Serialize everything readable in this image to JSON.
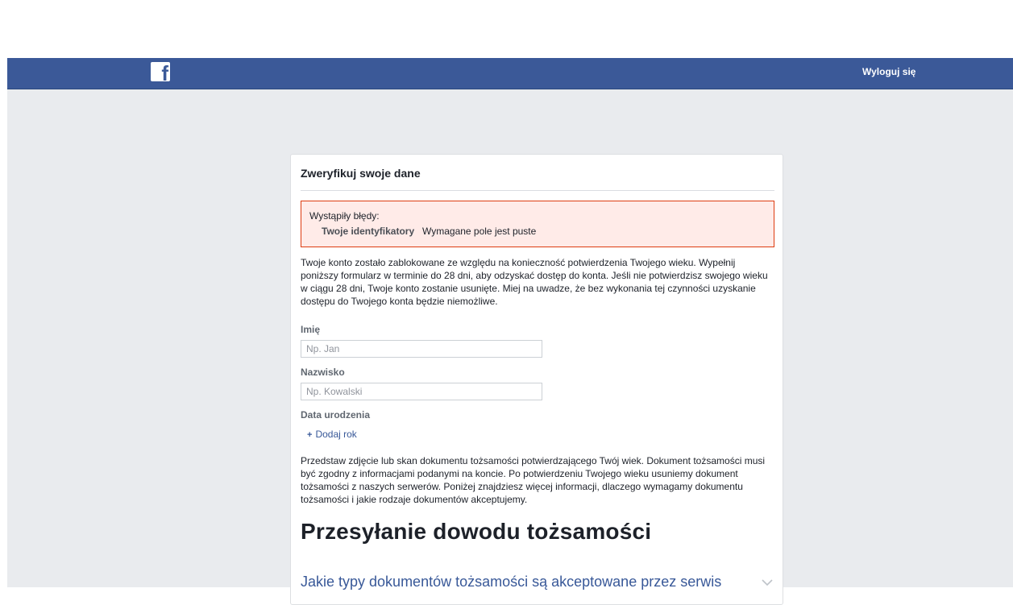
{
  "header": {
    "logo_icon": "facebook-f-logo",
    "logo_glyph": "f",
    "logout_label": "Wyloguj się",
    "brand_color": "#3b5998"
  },
  "card": {
    "title": "Zweryfikuj swoje dane",
    "error": {
      "heading": "Wystąpiły błędy:",
      "field": "Twoje identyfikatory",
      "message": "Wymagane pole jest puste"
    },
    "intro": "Twoje konto zostało zablokowane ze względu na konieczność potwierdzenia Twojego wieku. Wypełnij poniższy formularz w terminie do 28 dni, aby odzyskać dostęp do konta. Jeśli nie potwierdzisz swojego wieku w ciągu 28 dni, Twoje konto zostanie usunięte. Miej na uwadze, że bez wykonania tej czynności uzyskanie dostępu do Twojego konta będzie niemożliwe.",
    "first_name": {
      "label": "Imię",
      "placeholder": "Np. Jan",
      "value": ""
    },
    "last_name": {
      "label": "Nazwisko",
      "placeholder": "Np. Kowalski",
      "value": ""
    },
    "birth_date": {
      "label": "Data urodzenia",
      "add_year_symbol": "+",
      "add_year_label": "Dodaj rok"
    },
    "id_info": "Przedstaw zdjęcie lub skan dokumentu tożsamości potwierdzającego Twój wiek. Dokument tożsamości musi być zgodny z informacjami podanymi na koncie. Po potwierdzeniu Twojego wieku usuniemy dokument tożsamości z naszych serwerów. Poniżej znajdziesz więcej informacji, dlaczego wymagamy dokumentu tożsamości i jakie rodzaje dokumentów akceptujemy.",
    "upload_heading": "Przesyłanie dowodu tożsamości",
    "faq_question": "Jakie typy dokumentów tożsamości są akceptowane przez serwis",
    "faq_icon": "chevron-down-icon"
  }
}
